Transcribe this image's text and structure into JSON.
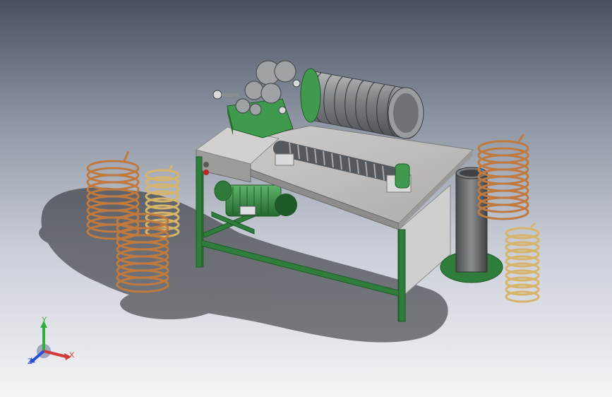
{
  "axes": {
    "x_label": "X",
    "y_label": "Y",
    "z_label": "Z"
  },
  "colors": {
    "frame": "#2e7d3a",
    "frame_dark": "#1f5a28",
    "metal": "#8a8d90",
    "metal_light": "#c6c8ca",
    "metal_dark": "#55585c",
    "copper": "#c07a3e",
    "gold": "#d8b46a",
    "tabletop": "#bdbcbb",
    "gearbox": "#3f9a4e"
  }
}
